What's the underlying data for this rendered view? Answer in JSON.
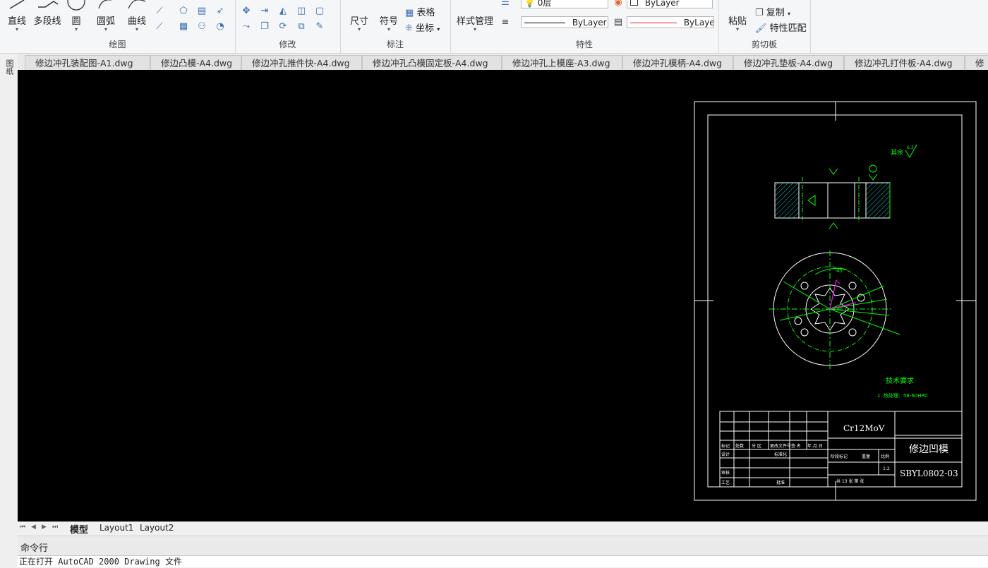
{
  "ribbon": {
    "draw": {
      "title": "绘图",
      "line": "直线",
      "polyline": "多段线",
      "circle": "圆",
      "arc": "圆弧",
      "curve": "曲线"
    },
    "modify": {
      "title": "修改"
    },
    "annotate": {
      "title": "标注",
      "dimension": "尺寸",
      "symbol": "符号",
      "table": "表格",
      "coordinate": "坐标"
    },
    "properties": {
      "title": "特性",
      "style_manager": "样式管理",
      "layer_value": "0层",
      "color_value": "ByLayer",
      "linetype_value": "ByLayer",
      "lineweight_value": "ByLaye"
    },
    "clipboard": {
      "title": "剪切板",
      "paste": "粘贴",
      "copy": "复制",
      "match_properties": "特性匹配"
    }
  },
  "document_tabs": [
    "修边冲孔装配图-A1.dwg",
    "修边凸模-A4.dwg",
    "修边冲孔推件快-A4.dwg",
    "修边冲孔凸模固定板-A4.dwg",
    "修边冲孔上模座-A3.dwg",
    "修边冲孔模柄-A4.dwg",
    "修边冲孔垫板-A4.dwg",
    "修边冲孔打件板-A4.dwg",
    "修"
  ],
  "sidebar": {
    "label": "图纸"
  },
  "drawing": {
    "roughness": "其余",
    "roughness_value": "6.3",
    "tech_title": "技术要求",
    "tech_note": "1. 热处理：58-60HRC",
    "material": "Cr12MoV",
    "part_name": "修边凹模",
    "drawing_no": "SBYL0802-03",
    "scale": "1:2",
    "sheet_info": "共 13 张   第   张",
    "angle_label": "45°",
    "tb_row1": [
      "标记",
      "处数",
      "分 区",
      "更改文件号",
      "签 名",
      "年.月.日"
    ],
    "tb_design": "设计",
    "tb_standard": "标准化",
    "tb_stage": "阶段标记",
    "tb_weight": "重量",
    "tb_ratio": "比例",
    "tb_review": "审核",
    "tb_process": "工艺",
    "tb_approve": "批准"
  },
  "layout_tabs": [
    "模型",
    "Layout1",
    "Layout2"
  ],
  "command": {
    "header": "命令行",
    "message": "正在打开 AutoCAD 2000 Drawing 文件"
  },
  "colors": {
    "canvas": "#000000",
    "geometry": "#ffffff",
    "annotation": "#00ff00",
    "centerline": "#00ff00",
    "highlight": "#ff00ff"
  }
}
